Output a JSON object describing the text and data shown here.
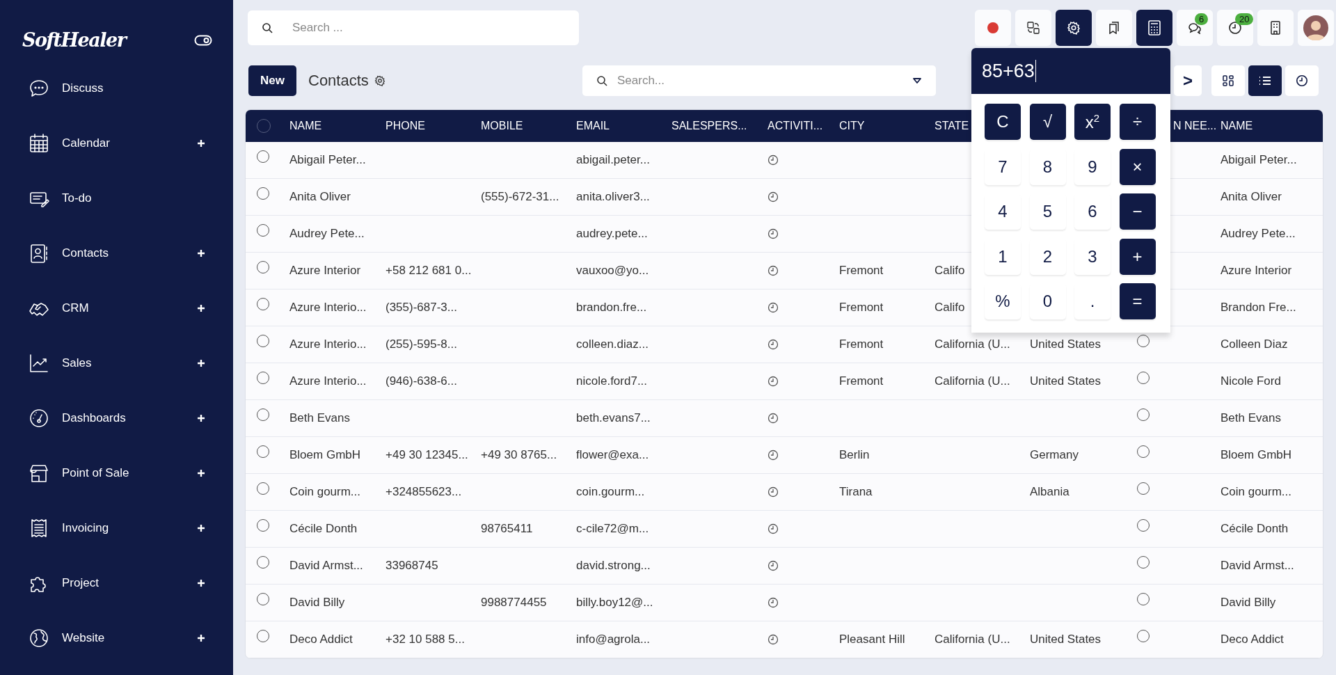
{
  "sidebar": {
    "logo": "SoftHealer",
    "items": [
      {
        "label": "Discuss",
        "expandable": false
      },
      {
        "label": "Calendar",
        "expandable": true
      },
      {
        "label": "To-do",
        "expandable": false
      },
      {
        "label": "Contacts",
        "expandable": true
      },
      {
        "label": "CRM",
        "expandable": true
      },
      {
        "label": "Sales",
        "expandable": true
      },
      {
        "label": "Dashboards",
        "expandable": true
      },
      {
        "label": "Point of Sale",
        "expandable": true
      },
      {
        "label": "Invoicing",
        "expandable": true
      },
      {
        "label": "Project",
        "expandable": true
      },
      {
        "label": "Website",
        "expandable": true
      }
    ]
  },
  "topbar": {
    "search": {
      "placeholder": "Search ..."
    },
    "tools": [
      {
        "kind": "record",
        "active": false
      },
      {
        "kind": "translate",
        "active": false
      },
      {
        "kind": "settings",
        "active": true
      },
      {
        "kind": "bookmark",
        "active": false
      },
      {
        "kind": "calculator",
        "active": true
      },
      {
        "kind": "chat",
        "active": false,
        "badge": "6"
      },
      {
        "kind": "activity",
        "active": false,
        "badge": "20"
      },
      {
        "kind": "company",
        "active": false
      },
      {
        "kind": "avatar",
        "active": false
      }
    ]
  },
  "control_panel": {
    "new_button": "New",
    "title": "Contacts",
    "search": {
      "placeholder": "Search..."
    },
    "pager_next": ">",
    "views": [
      {
        "kind": "kanban",
        "selected": false
      },
      {
        "kind": "list",
        "selected": true
      },
      {
        "kind": "activity",
        "selected": false
      }
    ]
  },
  "calculator": {
    "display": "85+63",
    "keys": [
      {
        "label": "C",
        "kind": "op"
      },
      {
        "label": "√",
        "kind": "op"
      },
      {
        "label": "x$^{2}$",
        "kind": "op"
      },
      {
        "label": "÷",
        "kind": "op"
      },
      {
        "label": "7",
        "kind": "num"
      },
      {
        "label": "8",
        "kind": "num"
      },
      {
        "label": "9",
        "kind": "num"
      },
      {
        "label": "×",
        "kind": "op"
      },
      {
        "label": "4",
        "kind": "num"
      },
      {
        "label": "5",
        "kind": "num"
      },
      {
        "label": "6",
        "kind": "num"
      },
      {
        "label": "−",
        "kind": "op"
      },
      {
        "label": "1",
        "kind": "num"
      },
      {
        "label": "2",
        "kind": "num"
      },
      {
        "label": "3",
        "kind": "num"
      },
      {
        "label": "+",
        "kind": "op"
      },
      {
        "label": "%",
        "kind": "num"
      },
      {
        "label": "0",
        "kind": "num"
      },
      {
        "label": ".",
        "kind": "num"
      },
      {
        "label": "=",
        "kind": "op"
      }
    ]
  },
  "table": {
    "all_selected": false,
    "columns": [
      "NAME",
      "PHONE",
      "MOBILE",
      "EMAIL",
      "SALESPERS...",
      "ACTIVITI...",
      "CITY",
      "STATE",
      null,
      "N NEE...",
      "NAME"
    ],
    "rows": [
      {
        "selected": false,
        "name": "Abigail Peter...",
        "email": "abigail.peter...",
        "display_name": "Abigail Peter..."
      },
      {
        "selected": false,
        "name": "Anita Oliver",
        "mobile": "(555)-672-31...",
        "email": "anita.oliver3...",
        "display_name": "Anita Oliver"
      },
      {
        "selected": false,
        "name": "Audrey Pete...",
        "email": "audrey.pete...",
        "display_name": "Audrey Pete..."
      },
      {
        "selected": false,
        "name": "Azure Interior",
        "phone": "+58 212 681 0...",
        "email": "vauxoo@yo...",
        "city": "Fremont",
        "state": "Califo",
        "display_name": "Azure Interior"
      },
      {
        "selected": false,
        "name": "Azure Interio...",
        "phone": "(355)-687-3...",
        "email": "brandon.fre...",
        "city": "Fremont",
        "state": "Califo",
        "display_name": "Brandon Fre..."
      },
      {
        "selected": false,
        "name": "Azure Interio...",
        "phone": "(255)-595-8...",
        "email": "colleen.diaz...",
        "city": "Fremont",
        "state": "California (U...",
        "country": "United States",
        "flag_checked": false,
        "display_name": "Colleen Diaz"
      },
      {
        "selected": false,
        "name": "Azure Interio...",
        "phone": "(946)-638-6...",
        "email": "nicole.ford7...",
        "city": "Fremont",
        "state": "California (U...",
        "country": "United States",
        "flag_checked": false,
        "display_name": "Nicole Ford"
      },
      {
        "selected": false,
        "name": "Beth Evans",
        "email": "beth.evans7...",
        "flag_checked": false,
        "display_name": "Beth Evans"
      },
      {
        "selected": false,
        "name": "Bloem GmbH",
        "phone": "+49 30 12345...",
        "mobile": "+49 30 8765...",
        "email": "flower@exa...",
        "city": "Berlin",
        "country": "Germany",
        "flag_checked": false,
        "display_name": "Bloem GmbH"
      },
      {
        "selected": false,
        "name": "Coin gourm...",
        "phone": "+324855623...",
        "email": "coin.gourm...",
        "city": "Tirana",
        "country": "Albania",
        "flag_checked": false,
        "display_name": "Coin gourm..."
      },
      {
        "selected": false,
        "name": "Cécile Donth",
        "mobile": "98765411",
        "email": "c-cile72@m...",
        "flag_checked": false,
        "display_name": "Cécile Donth"
      },
      {
        "selected": false,
        "name": "David Armst...",
        "phone": "33968745",
        "email": "david.strong...",
        "flag_checked": false,
        "display_name": "David Armst..."
      },
      {
        "selected": false,
        "name": "David Billy",
        "mobile": "9988774455",
        "email": "billy.boy12@...",
        "flag_checked": false,
        "display_name": "David Billy"
      },
      {
        "selected": false,
        "name": "Deco Addict",
        "phone": "+32 10 588 5...",
        "email": "info@agrola...",
        "city": "Pleasant Hill",
        "state": "California (U...",
        "country": "United States",
        "flag_checked": false,
        "display_name": "Deco Addict"
      }
    ]
  }
}
